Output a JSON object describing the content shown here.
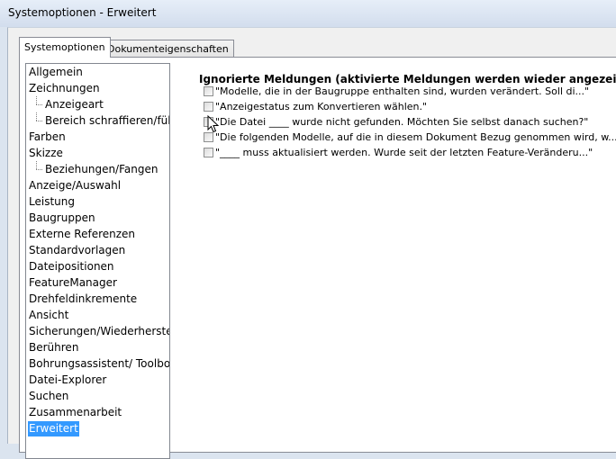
{
  "window": {
    "title": "Systemoptionen - Erweitert"
  },
  "tabs": [
    {
      "label": "Systemoptionen",
      "active": true
    },
    {
      "label": "Dokumenteigenschaften",
      "active": false
    }
  ],
  "tree": {
    "items": [
      {
        "label": "Allgemein",
        "level": 0,
        "selected": false
      },
      {
        "label": "Zeichnungen",
        "level": 0,
        "selected": false
      },
      {
        "label": "Anzeigeart",
        "level": 1,
        "selected": false
      },
      {
        "label": "Bereich schraffieren/füllen",
        "level": 1,
        "selected": false
      },
      {
        "label": "Farben",
        "level": 0,
        "selected": false
      },
      {
        "label": "Skizze",
        "level": 0,
        "selected": false
      },
      {
        "label": "Beziehungen/Fangen",
        "level": 1,
        "selected": false
      },
      {
        "label": "Anzeige/Auswahl",
        "level": 0,
        "selected": false
      },
      {
        "label": "Leistung",
        "level": 0,
        "selected": false
      },
      {
        "label": "Baugruppen",
        "level": 0,
        "selected": false
      },
      {
        "label": "Externe Referenzen",
        "level": 0,
        "selected": false
      },
      {
        "label": "Standardvorlagen",
        "level": 0,
        "selected": false
      },
      {
        "label": "Dateipositionen",
        "level": 0,
        "selected": false
      },
      {
        "label": "FeatureManager",
        "level": 0,
        "selected": false
      },
      {
        "label": "Drehfeldinkremente",
        "level": 0,
        "selected": false
      },
      {
        "label": "Ansicht",
        "level": 0,
        "selected": false
      },
      {
        "label": "Sicherungen/Wiederherstellen",
        "level": 0,
        "selected": false
      },
      {
        "label": "Berühren",
        "level": 0,
        "selected": false
      },
      {
        "label": "Bohrungsassistent/ Toolbox",
        "level": 0,
        "selected": false
      },
      {
        "label": "Datei-Explorer",
        "level": 0,
        "selected": false
      },
      {
        "label": "Suchen",
        "level": 0,
        "selected": false
      },
      {
        "label": "Zusammenarbeit",
        "level": 0,
        "selected": false
      },
      {
        "label": "Erweitert",
        "level": 0,
        "selected": true
      }
    ]
  },
  "ignored_messages": {
    "heading": "Ignorierte Meldungen (aktivierte Meldungen werden wieder angezeigt)",
    "items": [
      {
        "text": "\"Modelle, die in der Baugruppe enthalten sind, wurden verändert.  Soll di...\"",
        "checked": false
      },
      {
        "text": "\"Anzeigestatus zum Konvertieren wählen.\"",
        "checked": false
      },
      {
        "text": "\"Die Datei ____ wurde nicht  gefunden. Möchten Sie selbst danach suchen?\"",
        "checked": false
      },
      {
        "text": "\"Die folgenden Modelle, auf die in diesem Dokument Bezug genommen wird, w...\"",
        "checked": false
      },
      {
        "text": "\"____ muss aktualisiert werden.  Wurde seit der letzten Feature-Veränderu...\"",
        "checked": false
      }
    ]
  },
  "colors": {
    "selection": "#3399ff",
    "client_bg": "#f0f0f0",
    "frame_bg": "#dbe4ef"
  },
  "icons": {
    "cursor": "mouse-pointer-icon"
  }
}
